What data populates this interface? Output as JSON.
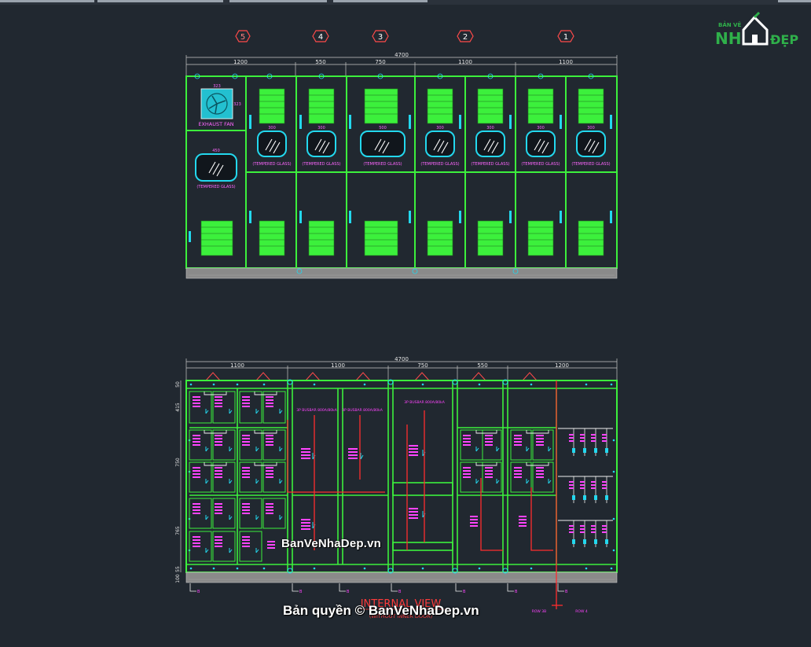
{
  "front_view": {
    "column_tags": [
      "5",
      "4",
      "3",
      "2",
      "1"
    ],
    "overall_dimension": "4700",
    "dimensions": [
      "1200",
      "550",
      "750",
      "1100",
      "1100"
    ],
    "fan_label": "EXHAUST FAN",
    "fan_size_w": "323",
    "fan_size_h": "323",
    "glass_label": "(TEMPERED GLASS)",
    "glass_size_small": "300",
    "glass_size_large": "450",
    "glass_size_mid": "500"
  },
  "internal_view": {
    "overall_dimension": "4700",
    "dimensions": [
      "1100",
      "1100",
      "750",
      "550",
      "1200"
    ],
    "left_heights": [
      "50",
      "415",
      "750",
      "765",
      "55"
    ],
    "base_height": "100",
    "title": "INTERNAL VIEW",
    "subtitle": "(WITHOUT INNER DOOR)",
    "section_marks": [
      "B",
      "B",
      "B",
      "B",
      "B",
      "B",
      "B"
    ],
    "busbar_labels": [
      "3P BUSBAR 800A/80kA",
      "3P BUSBAR 800A/80kA",
      "3P BUSBAR 800A/80kA"
    ],
    "busbar_row_labels": [
      "ROW 3B",
      "ROW 4"
    ]
  },
  "watermark": {
    "site": "BanVeNhaDep.vn",
    "copyright": "Bản quyền © BanVeNhaDep.vn",
    "logo_top": "BẢN VẼ",
    "logo_left": "NH",
    "logo_right": "ĐẸP"
  }
}
